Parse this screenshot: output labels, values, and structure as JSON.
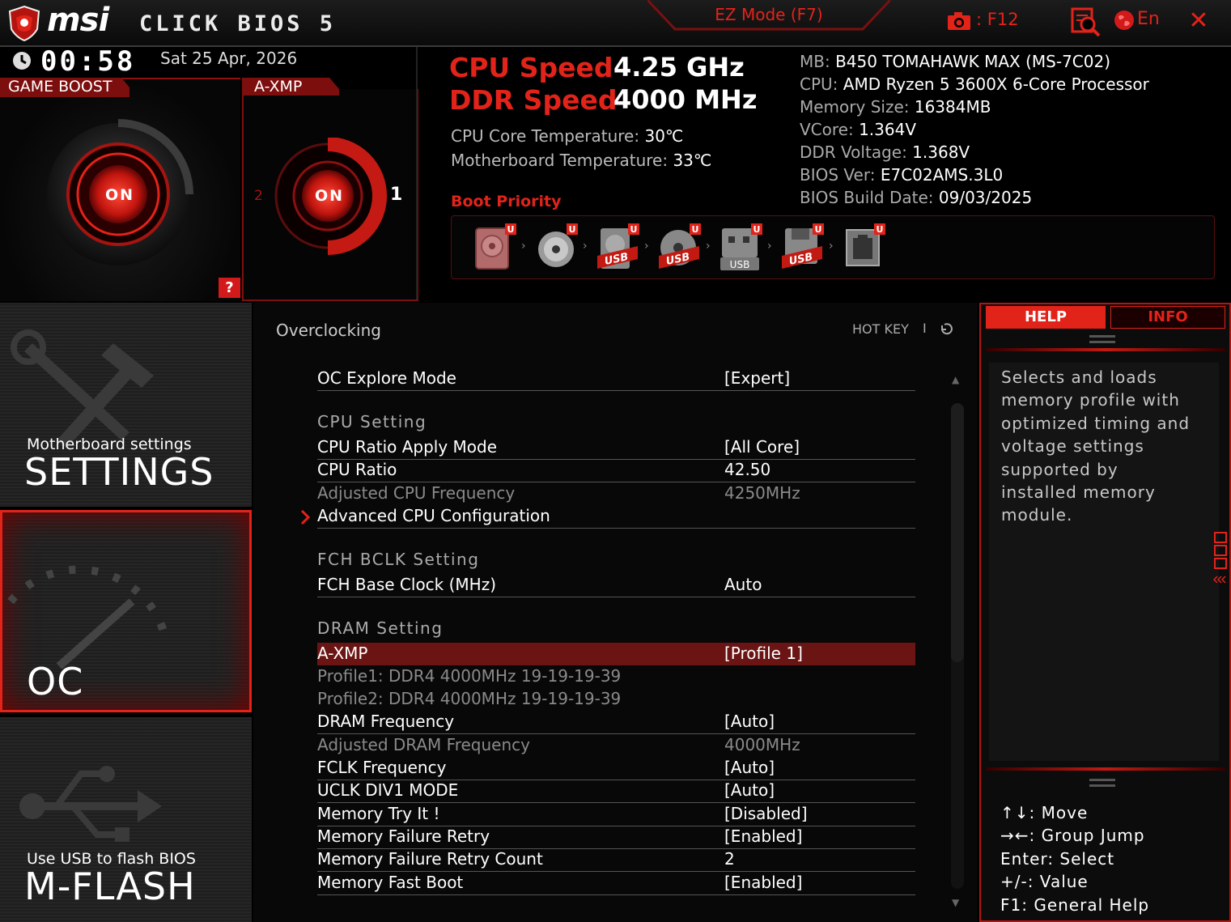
{
  "topbar": {
    "brand": "msi",
    "product": "CLICK BIOS 5",
    "ez_mode": "EZ Mode (F7)",
    "screenshot_key": "F12",
    "language": "En",
    "close": "✕"
  },
  "status": {
    "time": "00:58",
    "date": "Sat  25 Apr, 2026",
    "game_boost": {
      "label": "GAME BOOST",
      "state": "ON"
    },
    "axmp": {
      "label": "A-XMP",
      "state": "ON",
      "profile_left": "2",
      "profile_right": "1"
    },
    "help_button": "?",
    "cpu_speed_label": "CPU Speed",
    "cpu_speed_value": "4.25 GHz",
    "ddr_speed_label": "DDR Speed",
    "ddr_speed_value": "4000 MHz",
    "cpu_temp_label": "CPU Core Temperature:",
    "cpu_temp_value": "30℃",
    "mb_temp_label": "Motherboard Temperature:",
    "mb_temp_value": "33℃",
    "boot_priority_label": "Boot Priority",
    "boot_devices": [
      {
        "icon": "hdd-icon",
        "badge": "U"
      },
      {
        "icon": "optical-disc-icon",
        "badge": "U"
      },
      {
        "icon": "usb-hdd-icon",
        "badge": "U",
        "tag": "USB"
      },
      {
        "icon": "usb-cd-icon",
        "badge": "U",
        "tag": "USB"
      },
      {
        "icon": "usb-key-icon",
        "badge": "U",
        "tag": "USB"
      },
      {
        "icon": "usb-floppy-icon",
        "badge": "U",
        "tag": "USB"
      },
      {
        "icon": "network-icon",
        "badge": "U"
      }
    ]
  },
  "sysinfo": [
    {
      "label": "MB:",
      "value": "B450 TOMAHAWK MAX (MS-7C02)"
    },
    {
      "label": "CPU:",
      "value": "AMD Ryzen 5 3600X 6-Core Processor"
    },
    {
      "label": "Memory Size:",
      "value": "16384MB"
    },
    {
      "label": "VCore:",
      "value": "1.364V"
    },
    {
      "label": "DDR Voltage:",
      "value": "1.368V"
    },
    {
      "label": "BIOS Ver:",
      "value": "E7C02AMS.3L0"
    },
    {
      "label": "BIOS Build Date:",
      "value": "09/03/2025"
    }
  ],
  "nav": {
    "settings": {
      "small": "Motherboard settings",
      "big": "SETTINGS"
    },
    "oc": {
      "big": "OC"
    },
    "mflash": {
      "small": "Use USB to flash BIOS",
      "big": "M-FLASH"
    }
  },
  "main": {
    "title": "Overclocking",
    "hotkey": "HOT KEY",
    "hotkey_sep": "I",
    "rows": [
      {
        "key": "OC Explore Mode",
        "value": "[Expert]"
      },
      {
        "key": "CPU  Setting",
        "value": ""
      },
      {
        "key": "CPU Ratio Apply Mode",
        "value": "[All Core]"
      },
      {
        "key": "CPU Ratio",
        "value": "42.50"
      },
      {
        "key": "Adjusted CPU Frequency",
        "value": "4250MHz"
      },
      {
        "key": "Advanced CPU Configuration",
        "value": ""
      },
      {
        "key": "FCH  BCLK  Setting",
        "value": ""
      },
      {
        "key": "FCH Base Clock (MHz)",
        "value": "Auto"
      },
      {
        "key": "DRAM  Setting",
        "value": ""
      },
      {
        "key": "A-XMP",
        "value": "[Profile 1]"
      },
      {
        "key": "Profile1: DDR4 4000MHz 19-19-19-39",
        "value": ""
      },
      {
        "key": "Profile2: DDR4 4000MHz 19-19-19-39",
        "value": ""
      },
      {
        "key": "DRAM Frequency",
        "value": "[Auto]"
      },
      {
        "key": "Adjusted DRAM Frequency",
        "value": "4000MHz"
      },
      {
        "key": "FCLK Frequency",
        "value": "[Auto]"
      },
      {
        "key": "UCLK DIV1 MODE",
        "value": "[Auto]"
      },
      {
        "key": "Memory Try It !",
        "value": "[Disabled]"
      },
      {
        "key": "Memory Failure Retry",
        "value": "[Enabled]"
      },
      {
        "key": "Memory Failure Retry Count",
        "value": "2"
      },
      {
        "key": "Memory Fast Boot",
        "value": "[Enabled]"
      }
    ]
  },
  "help": {
    "tab_help": "HELP",
    "tab_info": "INFO",
    "text": "Selects and loads memory profile with optimized timing and voltage settings supported by installed memory module.",
    "keys": [
      "↑↓: Move",
      "→←: Group Jump",
      "Enter: Select",
      "+/-: Value",
      "F1: General Help"
    ]
  },
  "colors": {
    "accent": "#e2231a",
    "selected_row": "#6b1414",
    "dim_text": "#8a8a8a"
  }
}
